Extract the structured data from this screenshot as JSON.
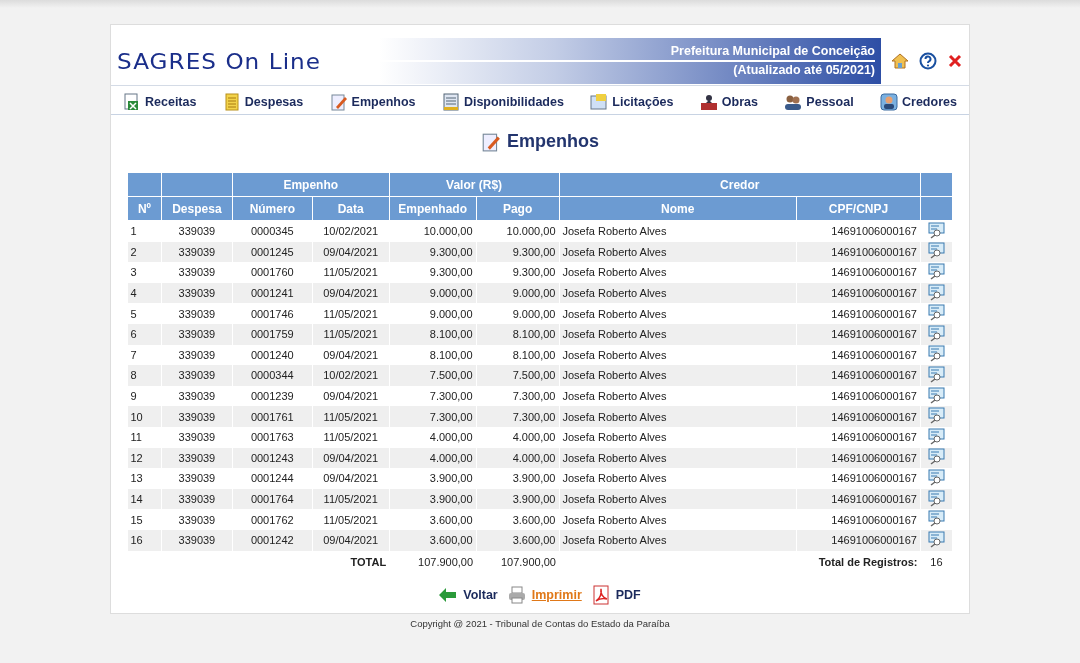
{
  "header": {
    "logo": "SAGRES On Line",
    "entity": "Prefeitura Municipal de Conceição",
    "updated": "(Atualizado até 05/2021)"
  },
  "nav": [
    {
      "label": "Receitas",
      "kind": "receitas"
    },
    {
      "label": "Despesas",
      "kind": "despesas"
    },
    {
      "label": "Empenhos",
      "kind": "empenhos"
    },
    {
      "label": "Disponibilidades",
      "kind": "disponibilidades"
    },
    {
      "label": "Licitações",
      "kind": "licitacoes"
    },
    {
      "label": "Obras",
      "kind": "obras"
    },
    {
      "label": "Pessoal",
      "kind": "pessoal"
    },
    {
      "label": "Credores",
      "kind": "credores"
    }
  ],
  "page_title": "Empenhos",
  "table": {
    "group_headers": [
      "Empenho",
      "Valor (R$)",
      "Credor"
    ],
    "columns": [
      "Nº",
      "Despesa",
      "Número",
      "Data",
      "Empenhado",
      "Pago",
      "Nome",
      "CPF/CNPJ"
    ],
    "rows": [
      [
        "1",
        "339039",
        "0000345",
        "10/02/2021",
        "10.000,00",
        "10.000,00",
        "Josefa Roberto Alves",
        "14691006000167"
      ],
      [
        "2",
        "339039",
        "0001245",
        "09/04/2021",
        "9.300,00",
        "9.300,00",
        "Josefa Roberto Alves",
        "14691006000167"
      ],
      [
        "3",
        "339039",
        "0001760",
        "11/05/2021",
        "9.300,00",
        "9.300,00",
        "Josefa Roberto Alves",
        "14691006000167"
      ],
      [
        "4",
        "339039",
        "0001241",
        "09/04/2021",
        "9.000,00",
        "9.000,00",
        "Josefa Roberto Alves",
        "14691006000167"
      ],
      [
        "5",
        "339039",
        "0001746",
        "11/05/2021",
        "9.000,00",
        "9.000,00",
        "Josefa Roberto Alves",
        "14691006000167"
      ],
      [
        "6",
        "339039",
        "0001759",
        "11/05/2021",
        "8.100,00",
        "8.100,00",
        "Josefa Roberto Alves",
        "14691006000167"
      ],
      [
        "7",
        "339039",
        "0001240",
        "09/04/2021",
        "8.100,00",
        "8.100,00",
        "Josefa Roberto Alves",
        "14691006000167"
      ],
      [
        "8",
        "339039",
        "0000344",
        "10/02/2021",
        "7.500,00",
        "7.500,00",
        "Josefa Roberto Alves",
        "14691006000167"
      ],
      [
        "9",
        "339039",
        "0001239",
        "09/04/2021",
        "7.300,00",
        "7.300,00",
        "Josefa Roberto Alves",
        "14691006000167"
      ],
      [
        "10",
        "339039",
        "0001761",
        "11/05/2021",
        "7.300,00",
        "7.300,00",
        "Josefa Roberto Alves",
        "14691006000167"
      ],
      [
        "11",
        "339039",
        "0001763",
        "11/05/2021",
        "4.000,00",
        "4.000,00",
        "Josefa Roberto Alves",
        "14691006000167"
      ],
      [
        "12",
        "339039",
        "0001243",
        "09/04/2021",
        "4.000,00",
        "4.000,00",
        "Josefa Roberto Alves",
        "14691006000167"
      ],
      [
        "13",
        "339039",
        "0001244",
        "09/04/2021",
        "3.900,00",
        "3.900,00",
        "Josefa Roberto Alves",
        "14691006000167"
      ],
      [
        "14",
        "339039",
        "0001764",
        "11/05/2021",
        "3.900,00",
        "3.900,00",
        "Josefa Roberto Alves",
        "14691006000167"
      ],
      [
        "15",
        "339039",
        "0001762",
        "11/05/2021",
        "3.600,00",
        "3.600,00",
        "Josefa Roberto Alves",
        "14691006000167"
      ],
      [
        "16",
        "339039",
        "0001242",
        "09/04/2021",
        "3.600,00",
        "3.600,00",
        "Josefa Roberto Alves",
        "14691006000167"
      ]
    ],
    "total_label": "TOTAL",
    "total_empenhado": "107.900,00",
    "total_pago": "107.900,00",
    "records_label": "Total de Registros:",
    "records_count": "16"
  },
  "actions": [
    {
      "label": "Voltar",
      "kind": "back"
    },
    {
      "label": "Imprimir",
      "kind": "print"
    },
    {
      "label": "PDF",
      "kind": "pdf"
    }
  ],
  "copyright": "Copyright @ 2021 - Tribunal de Contas do Estado da Paraíba"
}
